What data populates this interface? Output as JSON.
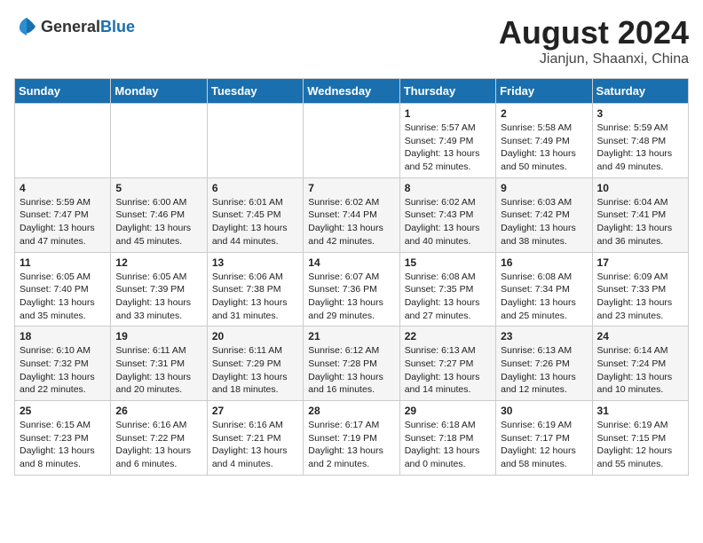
{
  "header": {
    "logo_general": "General",
    "logo_blue": "Blue",
    "month_year": "August 2024",
    "location": "Jianjun, Shaanxi, China"
  },
  "weekdays": [
    "Sunday",
    "Monday",
    "Tuesday",
    "Wednesday",
    "Thursday",
    "Friday",
    "Saturday"
  ],
  "weeks": [
    [
      {
        "day": "",
        "info": ""
      },
      {
        "day": "",
        "info": ""
      },
      {
        "day": "",
        "info": ""
      },
      {
        "day": "",
        "info": ""
      },
      {
        "day": "1",
        "info": "Sunrise: 5:57 AM\nSunset: 7:49 PM\nDaylight: 13 hours\nand 52 minutes."
      },
      {
        "day": "2",
        "info": "Sunrise: 5:58 AM\nSunset: 7:49 PM\nDaylight: 13 hours\nand 50 minutes."
      },
      {
        "day": "3",
        "info": "Sunrise: 5:59 AM\nSunset: 7:48 PM\nDaylight: 13 hours\nand 49 minutes."
      }
    ],
    [
      {
        "day": "4",
        "info": "Sunrise: 5:59 AM\nSunset: 7:47 PM\nDaylight: 13 hours\nand 47 minutes."
      },
      {
        "day": "5",
        "info": "Sunrise: 6:00 AM\nSunset: 7:46 PM\nDaylight: 13 hours\nand 45 minutes."
      },
      {
        "day": "6",
        "info": "Sunrise: 6:01 AM\nSunset: 7:45 PM\nDaylight: 13 hours\nand 44 minutes."
      },
      {
        "day": "7",
        "info": "Sunrise: 6:02 AM\nSunset: 7:44 PM\nDaylight: 13 hours\nand 42 minutes."
      },
      {
        "day": "8",
        "info": "Sunrise: 6:02 AM\nSunset: 7:43 PM\nDaylight: 13 hours\nand 40 minutes."
      },
      {
        "day": "9",
        "info": "Sunrise: 6:03 AM\nSunset: 7:42 PM\nDaylight: 13 hours\nand 38 minutes."
      },
      {
        "day": "10",
        "info": "Sunrise: 6:04 AM\nSunset: 7:41 PM\nDaylight: 13 hours\nand 36 minutes."
      }
    ],
    [
      {
        "day": "11",
        "info": "Sunrise: 6:05 AM\nSunset: 7:40 PM\nDaylight: 13 hours\nand 35 minutes."
      },
      {
        "day": "12",
        "info": "Sunrise: 6:05 AM\nSunset: 7:39 PM\nDaylight: 13 hours\nand 33 minutes."
      },
      {
        "day": "13",
        "info": "Sunrise: 6:06 AM\nSunset: 7:38 PM\nDaylight: 13 hours\nand 31 minutes."
      },
      {
        "day": "14",
        "info": "Sunrise: 6:07 AM\nSunset: 7:36 PM\nDaylight: 13 hours\nand 29 minutes."
      },
      {
        "day": "15",
        "info": "Sunrise: 6:08 AM\nSunset: 7:35 PM\nDaylight: 13 hours\nand 27 minutes."
      },
      {
        "day": "16",
        "info": "Sunrise: 6:08 AM\nSunset: 7:34 PM\nDaylight: 13 hours\nand 25 minutes."
      },
      {
        "day": "17",
        "info": "Sunrise: 6:09 AM\nSunset: 7:33 PM\nDaylight: 13 hours\nand 23 minutes."
      }
    ],
    [
      {
        "day": "18",
        "info": "Sunrise: 6:10 AM\nSunset: 7:32 PM\nDaylight: 13 hours\nand 22 minutes."
      },
      {
        "day": "19",
        "info": "Sunrise: 6:11 AM\nSunset: 7:31 PM\nDaylight: 13 hours\nand 20 minutes."
      },
      {
        "day": "20",
        "info": "Sunrise: 6:11 AM\nSunset: 7:29 PM\nDaylight: 13 hours\nand 18 minutes."
      },
      {
        "day": "21",
        "info": "Sunrise: 6:12 AM\nSunset: 7:28 PM\nDaylight: 13 hours\nand 16 minutes."
      },
      {
        "day": "22",
        "info": "Sunrise: 6:13 AM\nSunset: 7:27 PM\nDaylight: 13 hours\nand 14 minutes."
      },
      {
        "day": "23",
        "info": "Sunrise: 6:13 AM\nSunset: 7:26 PM\nDaylight: 13 hours\nand 12 minutes."
      },
      {
        "day": "24",
        "info": "Sunrise: 6:14 AM\nSunset: 7:24 PM\nDaylight: 13 hours\nand 10 minutes."
      }
    ],
    [
      {
        "day": "25",
        "info": "Sunrise: 6:15 AM\nSunset: 7:23 PM\nDaylight: 13 hours\nand 8 minutes."
      },
      {
        "day": "26",
        "info": "Sunrise: 6:16 AM\nSunset: 7:22 PM\nDaylight: 13 hours\nand 6 minutes."
      },
      {
        "day": "27",
        "info": "Sunrise: 6:16 AM\nSunset: 7:21 PM\nDaylight: 13 hours\nand 4 minutes."
      },
      {
        "day": "28",
        "info": "Sunrise: 6:17 AM\nSunset: 7:19 PM\nDaylight: 13 hours\nand 2 minutes."
      },
      {
        "day": "29",
        "info": "Sunrise: 6:18 AM\nSunset: 7:18 PM\nDaylight: 13 hours\nand 0 minutes."
      },
      {
        "day": "30",
        "info": "Sunrise: 6:19 AM\nSunset: 7:17 PM\nDaylight: 12 hours\nand 58 minutes."
      },
      {
        "day": "31",
        "info": "Sunrise: 6:19 AM\nSunset: 7:15 PM\nDaylight: 12 hours\nand 55 minutes."
      }
    ]
  ]
}
